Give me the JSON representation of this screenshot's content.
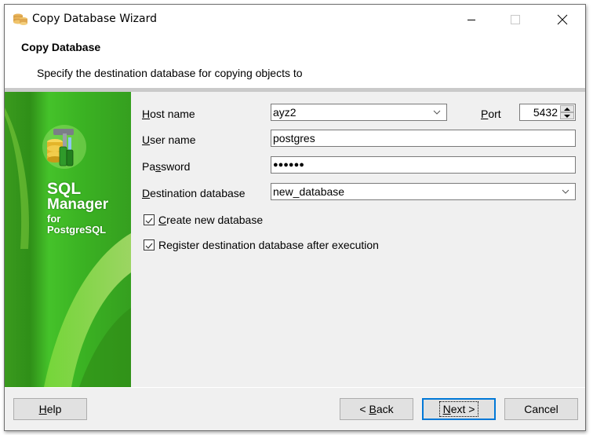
{
  "window": {
    "title": "Copy Database Wizard",
    "icon": "database-stack-icon"
  },
  "header": {
    "title": "Copy Database",
    "subtitle": "Specify the destination database for copying objects to"
  },
  "banner": {
    "line1": "SQL",
    "line2": "Manager",
    "line3": "for",
    "line4": "PostgreSQL",
    "accent_color": "#3bb323"
  },
  "form": {
    "host": {
      "label_u": "H",
      "label_rest": "ost name",
      "value": "ayz2"
    },
    "port": {
      "label_u": "P",
      "label_rest": "ort",
      "value": "5432"
    },
    "user": {
      "label_u": "U",
      "label_rest": "ser name",
      "value": "postgres"
    },
    "password": {
      "label_pre": "Pa",
      "label_u": "s",
      "label_rest": "sword",
      "value": "●●●●●●"
    },
    "dest": {
      "label_u": "D",
      "label_rest": "estination database",
      "value": "new_database"
    },
    "create_new": {
      "label_u": "C",
      "label_rest": "reate new database",
      "checked": true
    },
    "register": {
      "label": "Register destination database after execution",
      "checked": true
    }
  },
  "buttons": {
    "help_u": "H",
    "help_rest": "elp",
    "back_pre": "< ",
    "back_u": "B",
    "back_rest": "ack",
    "next_u": "N",
    "next_rest": "ext >",
    "cancel": "Cancel",
    "focus_color": "#0078d7"
  }
}
